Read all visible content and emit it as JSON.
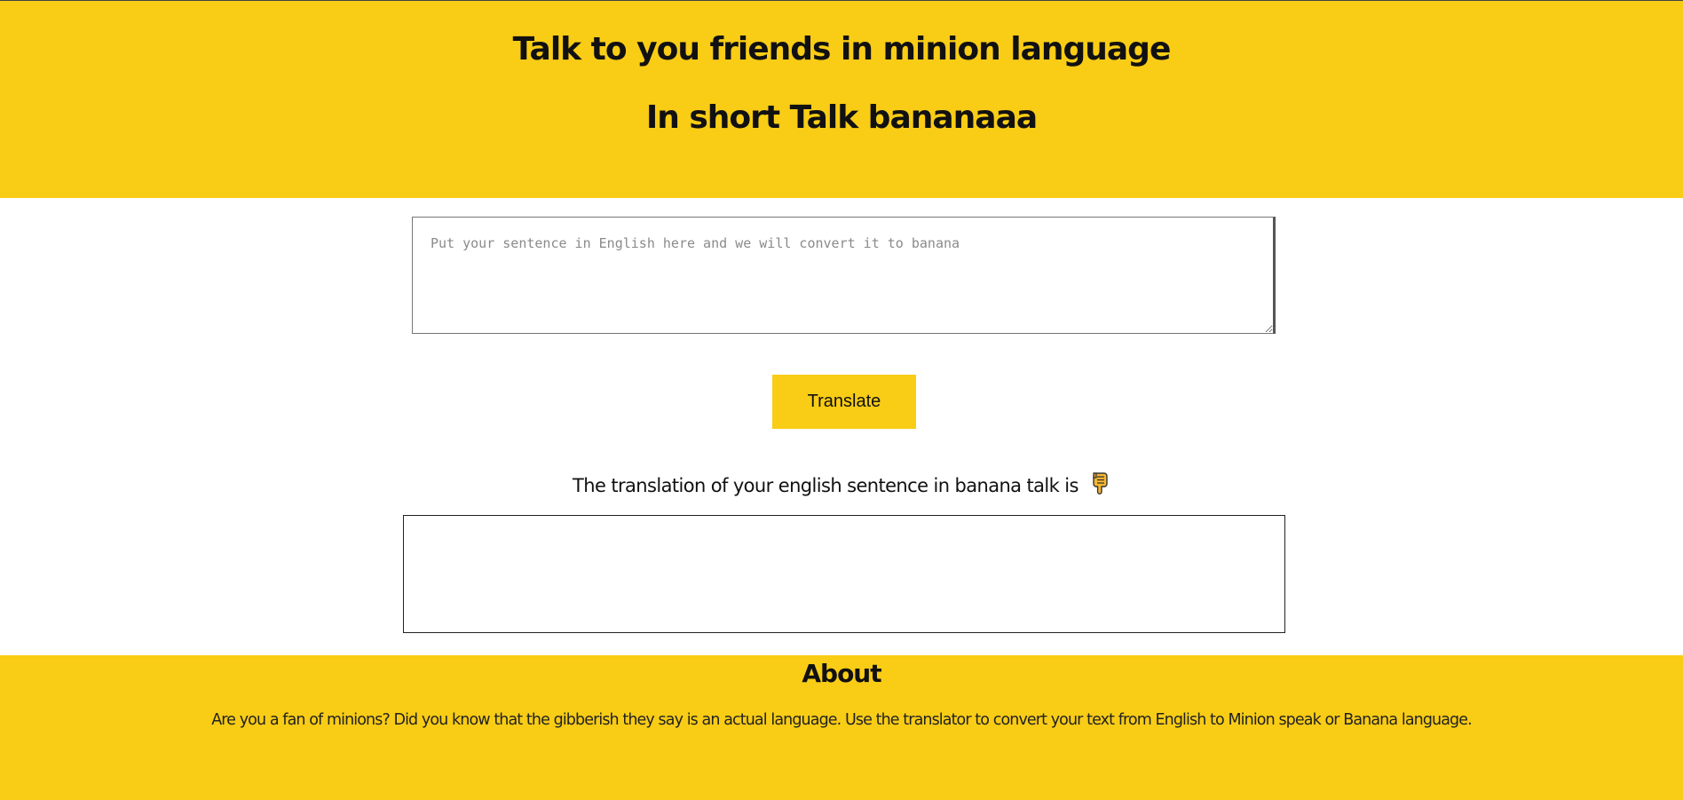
{
  "header": {
    "title": "Talk to you friends in minion language",
    "subtitle": "In short Talk bananaaa"
  },
  "input": {
    "placeholder": "Put your sentence in English here and we will convert it to banana",
    "value": ""
  },
  "translate_button": {
    "label": "Translate"
  },
  "result": {
    "label": "The translation of your english sentence in banana talk is",
    "icon": "pointing-down-hand-icon",
    "output": ""
  },
  "about": {
    "title": "About",
    "text": "Are you a fan of minions? Did you know that the gibberish they say is an actual language. Use the translator to convert your text from English to Minion speak or Banana language."
  },
  "colors": {
    "accent": "#f9cc16",
    "text": "#111111",
    "background": "#ffffff"
  }
}
